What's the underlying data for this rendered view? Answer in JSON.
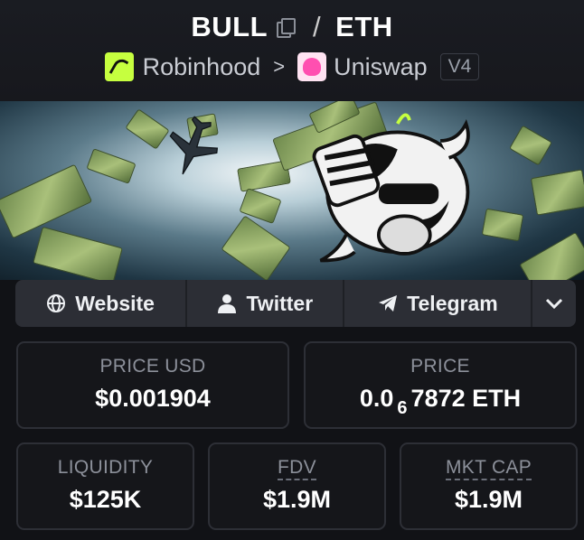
{
  "pair": {
    "base": "BULL",
    "quote": "ETH",
    "separator": "/"
  },
  "route": {
    "chain": "Robinhood",
    "dex": "Uniswap",
    "version": "V4",
    "chevron": ">"
  },
  "links": {
    "website": "Website",
    "twitter": "Twitter",
    "telegram": "Telegram",
    "more_icon": "chevron-down-icon"
  },
  "stats": {
    "price_usd": {
      "label": "PRICE USD",
      "value": "$0.001904"
    },
    "price_native": {
      "label": "PRICE",
      "value_prefix": "0.0",
      "zero_count": "6",
      "value_suffix": "7872 ETH"
    },
    "liquidity": {
      "label": "LIQUIDITY",
      "value": "$125K"
    },
    "fdv": {
      "label": "FDV",
      "value": "$1.9M"
    },
    "mkt_cap": {
      "label": "MKT CAP",
      "value": "$1.9M"
    }
  },
  "colors": {
    "background": "#111216",
    "card_border": "#2d2f36",
    "robinhood": "#c6ff3f",
    "uniswap": "#ff4fb0"
  }
}
